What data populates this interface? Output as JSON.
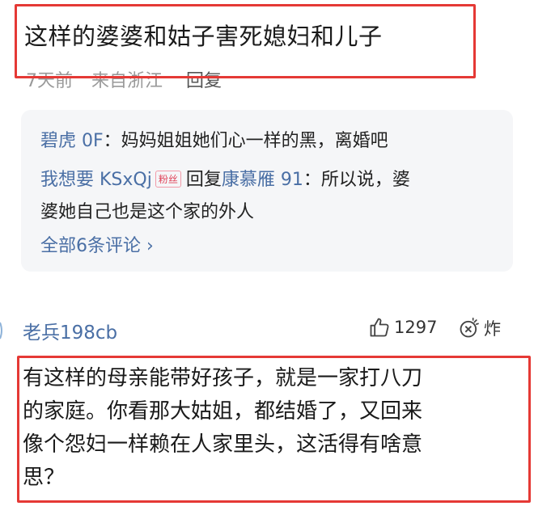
{
  "comment1": {
    "text": "这样的婆婆和姑子害死媳妇和儿子",
    "meta": {
      "time": "7天前",
      "location": "来自浙江",
      "reply": "回复"
    }
  },
  "replies": {
    "items": [
      {
        "user": "碧虎 0F",
        "sep": "：",
        "text": "妈妈姐姐她们心一样的黑，离婚吧"
      },
      {
        "user": "我想要 KSxQj",
        "badge": "粉丝",
        "prefix": "回复",
        "target": "康慕雁 91",
        "sep": "：",
        "text_line1": "所以说，婆",
        "text_line2": "婆她自己也是这个家的外人"
      }
    ],
    "view_all": "全部6条评论 ›"
  },
  "comment2": {
    "username": "老兵198cb",
    "likes": "1297",
    "boom_label": "炸",
    "lines": [
      "有这样的母亲能带好孩子，就是一家打八刀",
      "的家庭。你看那大姑姐，都结婚了，又回来",
      "像个怨妇一样赖在人家里头，这活得有啥意",
      "思？"
    ]
  },
  "colors": {
    "highlight": "#e53935",
    "link": "#4a6fa5",
    "meta": "#999999",
    "reply_bg": "#f5f6f8"
  },
  "icons": [
    "thumbs-up-icon",
    "boom-icon"
  ]
}
